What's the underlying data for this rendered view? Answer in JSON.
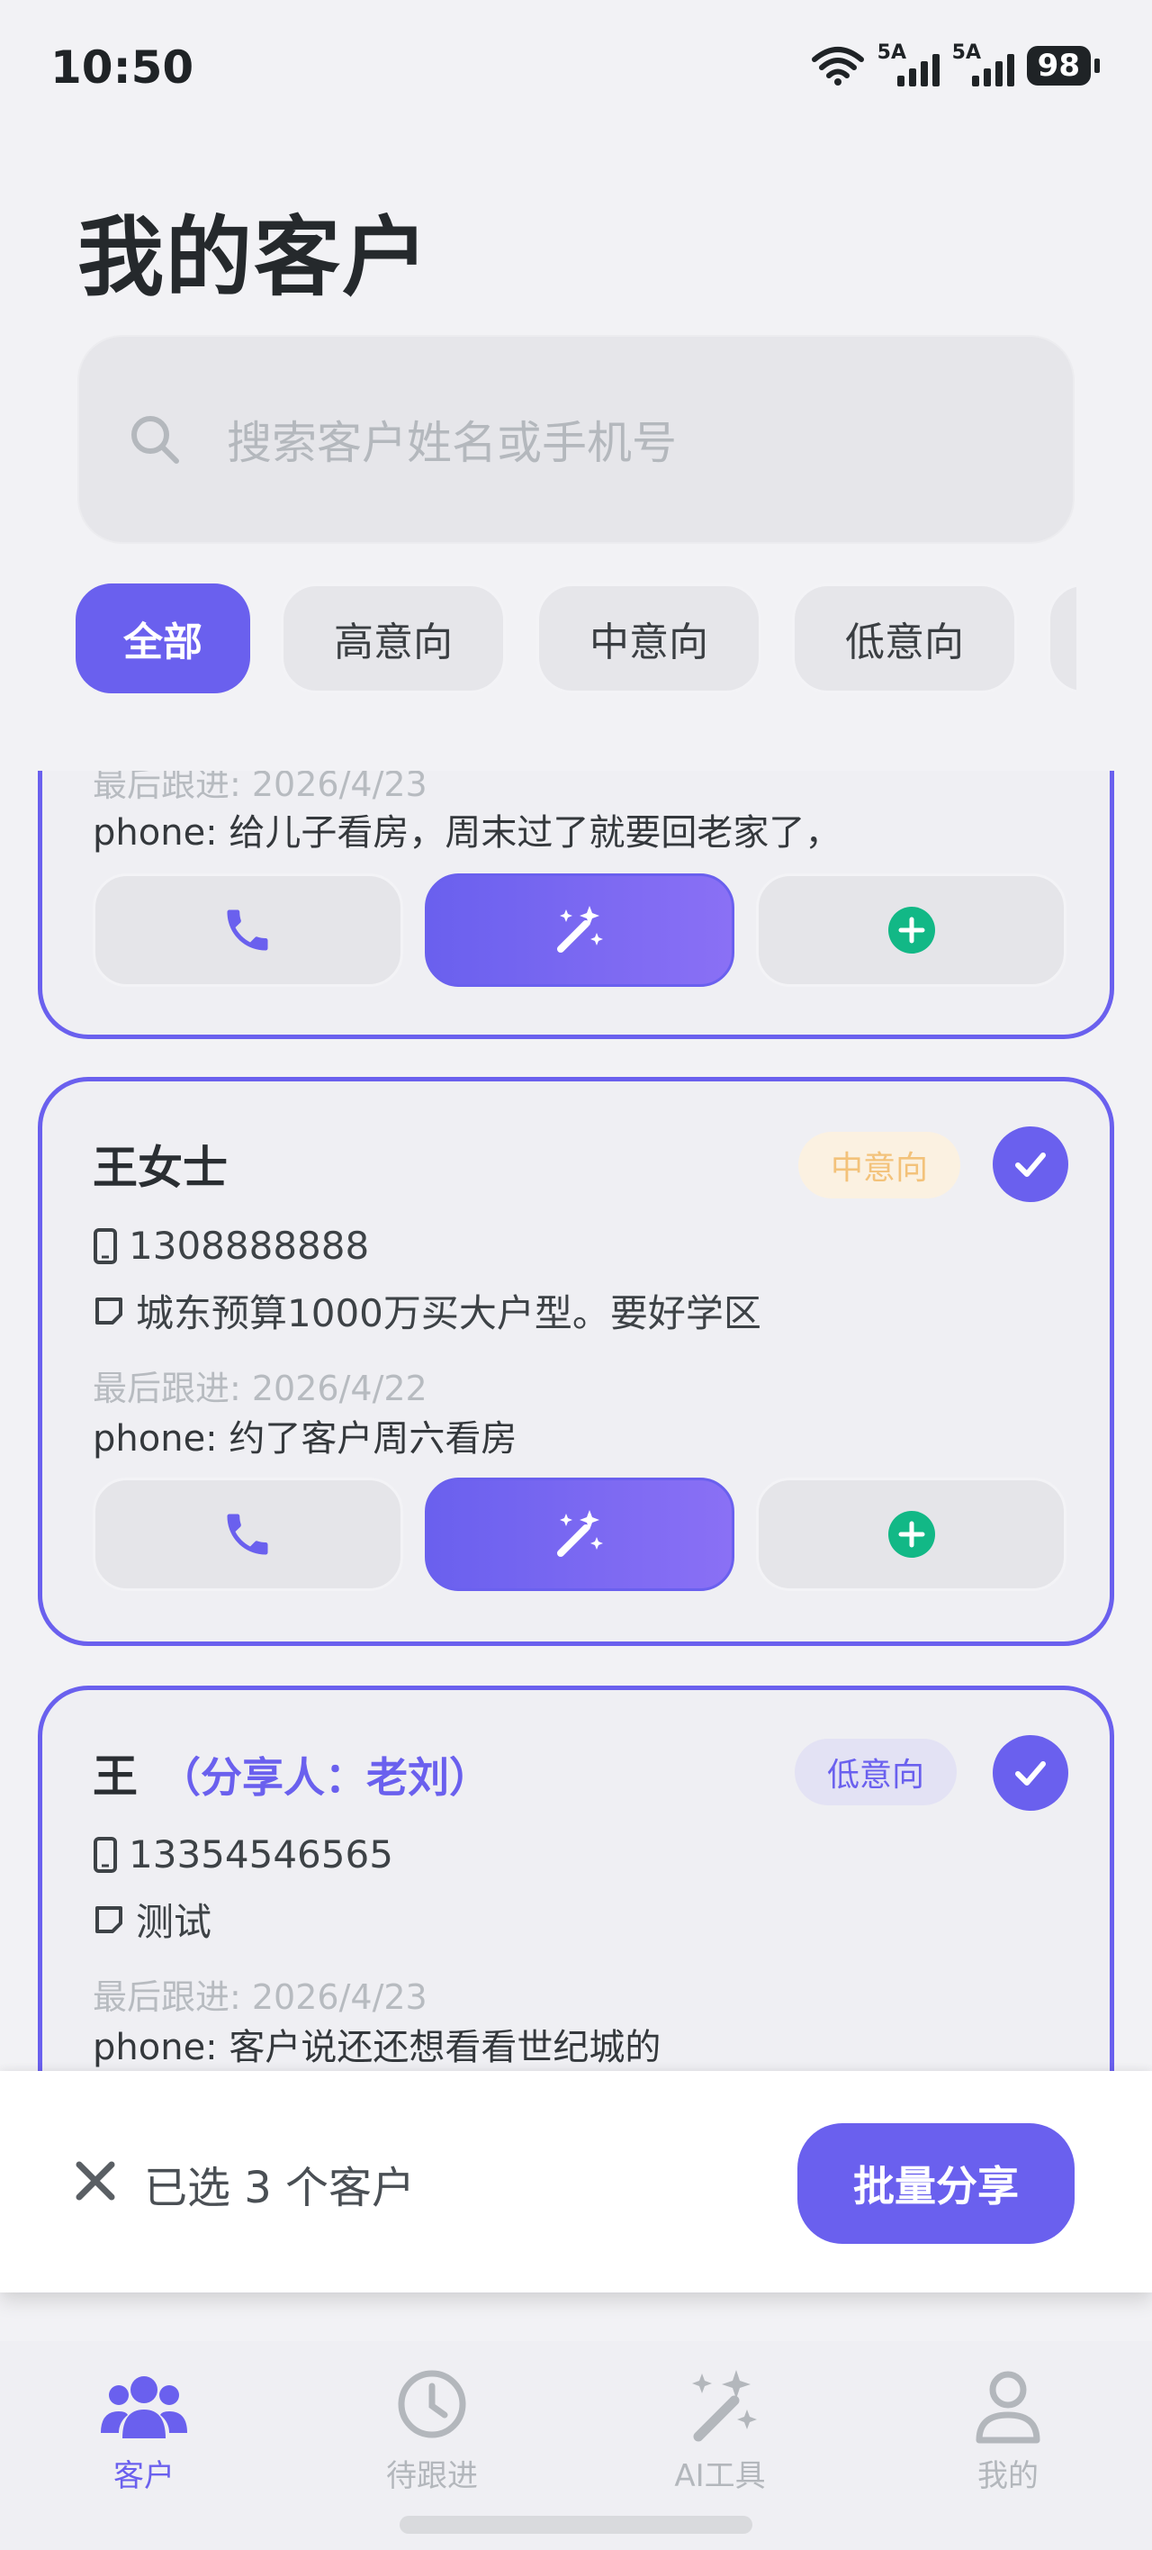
{
  "status_bar": {
    "time": "10:50",
    "signal1": "5A",
    "signal2": "5A",
    "battery": "98"
  },
  "page_title": "我的客户",
  "search": {
    "placeholder": "搜索客户姓名或手机号",
    "icon": "search-icon"
  },
  "filters": [
    {
      "label": "全部",
      "active": true
    },
    {
      "label": "高意向",
      "active": false
    },
    {
      "label": "中意向",
      "active": false
    },
    {
      "label": "低意向",
      "active": false
    },
    {
      "label": "",
      "active": false
    }
  ],
  "customers": [
    {
      "name": "",
      "last_follow": "最后跟进: 2026/4/23",
      "note_line": "phone: 给儿子看房，周末过了就要回老家了，"
    },
    {
      "name": "王女士",
      "intent": "中意向",
      "phone": "1308888888",
      "memo": "城东预算1000万买大户型。要好学区",
      "last_follow": "最后跟进: 2026/4/22",
      "note_line": "phone: 约了客户周六看房",
      "selected": true
    },
    {
      "name": "王",
      "sharer": "（分享人：老刘）",
      "intent": "低意向",
      "phone": "13354546565",
      "memo": "测试",
      "last_follow": "最后跟进: 2026/4/23",
      "note_line": "phone: 客户说还还想看看世纪城的",
      "selected": true
    }
  ],
  "selection_bar": {
    "selected_text": "已选 3 个客户",
    "bulk_share": "批量分享"
  },
  "tab_bar": [
    {
      "label": "客户",
      "icon": "users-icon",
      "active": true
    },
    {
      "label": "待跟进",
      "icon": "clock-icon",
      "active": false
    },
    {
      "label": "AI工具",
      "icon": "magic-wand-icon",
      "active": false
    },
    {
      "label": "我的",
      "icon": "person-icon",
      "active": false
    }
  ],
  "colors": {
    "accent": "#6a60ee",
    "mid_intent": "#f3c27a",
    "add_green": "#12b886"
  }
}
